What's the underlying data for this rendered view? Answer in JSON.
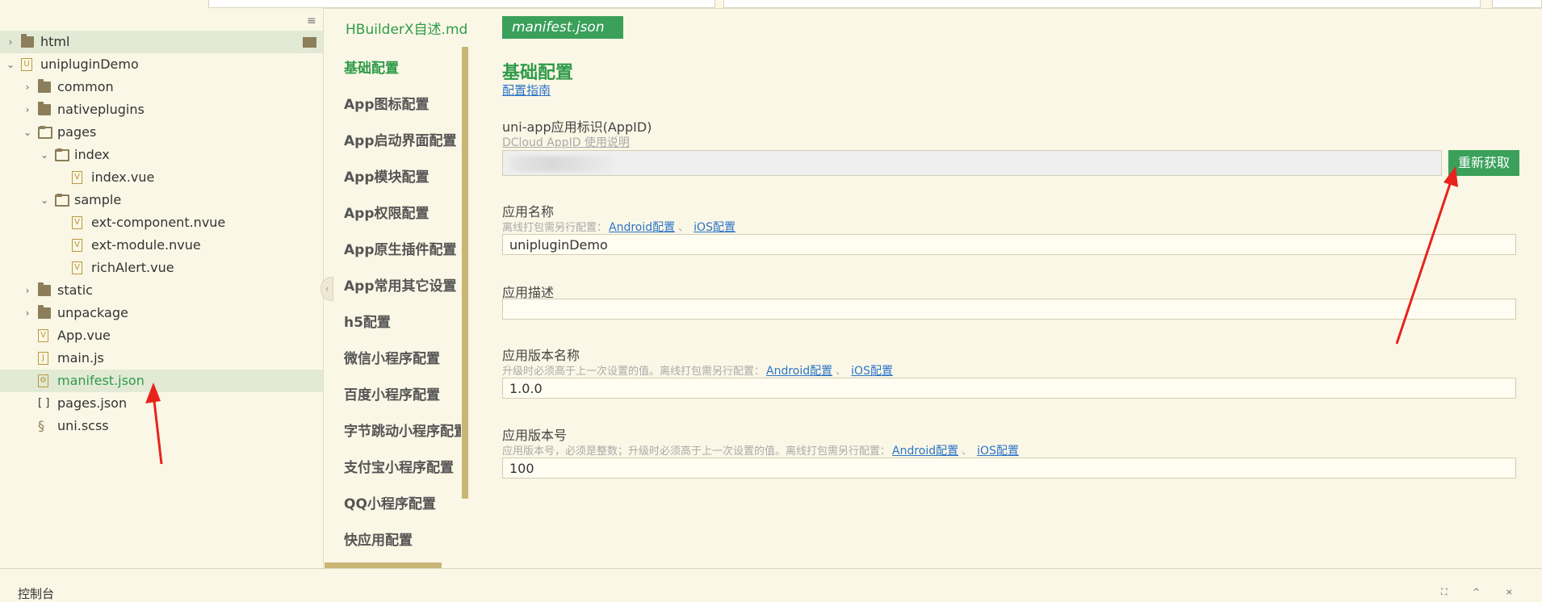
{
  "sidebar": {
    "tree": [
      {
        "label": "html",
        "kind": "folder",
        "indent": 0,
        "expanded": false,
        "selected": true
      },
      {
        "label": "unipluginDemo",
        "kind": "project",
        "indent": 0,
        "expanded": true
      },
      {
        "label": "common",
        "kind": "folder",
        "indent": 1,
        "expanded": false
      },
      {
        "label": "nativeplugins",
        "kind": "folder",
        "indent": 1,
        "expanded": false
      },
      {
        "label": "pages",
        "kind": "folder-open",
        "indent": 1,
        "expanded": true
      },
      {
        "label": "index",
        "kind": "folder-open",
        "indent": 2,
        "expanded": true
      },
      {
        "label": "index.vue",
        "kind": "vue",
        "indent": 3
      },
      {
        "label": "sample",
        "kind": "folder-open",
        "indent": 2,
        "expanded": true
      },
      {
        "label": "ext-component.nvue",
        "kind": "vue",
        "indent": 3
      },
      {
        "label": "ext-module.nvue",
        "kind": "vue",
        "indent": 3
      },
      {
        "label": "richAlert.vue",
        "kind": "vue",
        "indent": 3
      },
      {
        "label": "static",
        "kind": "folder",
        "indent": 1,
        "expanded": false
      },
      {
        "label": "unpackage",
        "kind": "folder",
        "indent": 1,
        "expanded": false
      },
      {
        "label": "App.vue",
        "kind": "vue",
        "indent": 1
      },
      {
        "label": "main.js",
        "kind": "js",
        "indent": 1
      },
      {
        "label": "manifest.json",
        "kind": "json-gear",
        "indent": 1,
        "active": true
      },
      {
        "label": "pages.json",
        "kind": "json",
        "indent": 1
      },
      {
        "label": "uni.scss",
        "kind": "scss",
        "indent": 1
      }
    ]
  },
  "nav": {
    "tab_title": "HBuilderX自述.md",
    "items": [
      "基础配置",
      "App图标配置",
      "App启动界面配置",
      "App模块配置",
      "App权限配置",
      "App原生插件配置",
      "App常用其它设置",
      "h5配置",
      "微信小程序配置",
      "百度小程序配置",
      "字节跳动小程序配置",
      "支付宝小程序配置",
      "QQ小程序配置",
      "快应用配置"
    ]
  },
  "main": {
    "tab_label": "manifest.json",
    "section_title": "基础配置",
    "guide_link": "配置指南",
    "appid": {
      "label": "uni-app应用标识(AppID)",
      "help_link": "DCloud AppID 使用说明",
      "refresh_button": "重新获取"
    },
    "name": {
      "label": "应用名称",
      "hint": "离线打包需另行配置：",
      "android_link": "Android配置",
      "sep": "、",
      "ios_link": "iOS配置",
      "value": "unipluginDemo"
    },
    "description": {
      "label": "应用描述",
      "value": ""
    },
    "version_name": {
      "label": "应用版本名称",
      "hint": "升级时必须高于上一次设置的值。离线打包需另行配置：",
      "android_link": "Android配置",
      "sep": "、",
      "ios_link": "iOS配置",
      "value": "1.0.0"
    },
    "version_code": {
      "label": "应用版本号",
      "hint": "应用版本号，必须是整数；升级时必须高于上一次设置的值。离线打包需另行配置：",
      "android_link": "Android配置",
      "sep": "、",
      "ios_link": "iOS配置",
      "value": "100"
    }
  },
  "console": {
    "title": "控制台"
  },
  "colors": {
    "accent_green": "#3aa05a",
    "link_blue": "#2b74c8",
    "background": "#fbf7e6",
    "annotation_arrow": "#e8231c"
  }
}
